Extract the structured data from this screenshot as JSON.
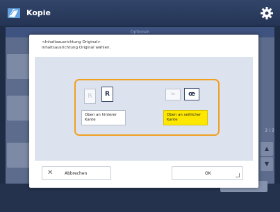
{
  "titlebar": {
    "title": "Kopie",
    "app_icon": "copy-app-icon",
    "settings_icon": "gear-icon"
  },
  "background": {
    "tab_label": "Optionen",
    "page_indicator": "2 / 2",
    "scroll_up": "▲",
    "scroll_down": "▼"
  },
  "dialog": {
    "title": "<Inhaltsausrichtung Original>",
    "instruction": "Inhaltsausrichtung Original wählen.",
    "options": [
      {
        "label": "Oben an hinterer Kante",
        "icon_a": "R",
        "icon_b": "R",
        "selected": false
      },
      {
        "label": "Oben an seitlicher Kante",
        "icon_a": "≃",
        "icon_b": "œ",
        "selected": true
      }
    ],
    "cancel_label": "Abbrechen",
    "ok_label": "OK"
  },
  "colors": {
    "accent": "#f0a01e",
    "selected_fill": "#ffe800",
    "titlebar": "#2c3e61"
  }
}
